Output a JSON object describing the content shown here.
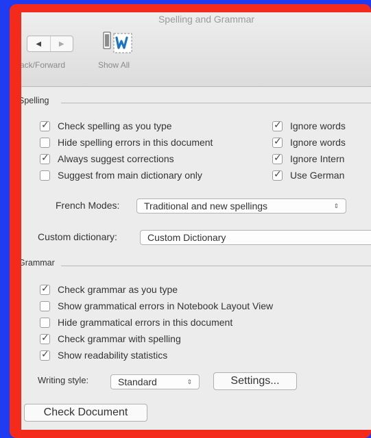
{
  "window": {
    "title": "Spelling and Grammar"
  },
  "toolbar": {
    "nav_back_glyph": "◀",
    "nav_forward_glyph": "▶",
    "back_forward_label": "ack/Forward",
    "show_all_label": "Show All",
    "show_all_icon": "show-all-icon"
  },
  "spelling": {
    "header": "Spelling",
    "left_options": [
      {
        "label": "Check spelling as you type",
        "checked": true
      },
      {
        "label": "Hide spelling errors in this document",
        "checked": false
      },
      {
        "label": "Always suggest corrections",
        "checked": true
      },
      {
        "label": "Suggest from main dictionary only",
        "checked": false
      }
    ],
    "right_options": [
      {
        "label": "Ignore words",
        "checked": true
      },
      {
        "label": "Ignore words",
        "checked": true
      },
      {
        "label": "Ignore Intern",
        "checked": true
      },
      {
        "label": "Use German",
        "checked": true
      }
    ],
    "french_modes_label": "French Modes:",
    "french_modes_value": "Traditional and new spellings",
    "custom_dict_label": "Custom dictionary:",
    "custom_dict_value": "Custom Dictionary"
  },
  "grammar": {
    "header": "Grammar",
    "options": [
      {
        "label": "Check grammar as you type",
        "checked": true
      },
      {
        "label": "Show grammatical errors in Notebook Layout View",
        "checked": false
      },
      {
        "label": "Hide grammatical errors in this document",
        "checked": false
      },
      {
        "label": "Check grammar with spelling",
        "checked": true
      },
      {
        "label": "Show readability statistics",
        "checked": true
      }
    ],
    "writing_style_label": "Writing style:",
    "writing_style_value": "Standard",
    "settings_button": "Settings..."
  },
  "check_document_button": "Check Document",
  "tick_glyph": "✓",
  "updown_glyph": "⇕"
}
